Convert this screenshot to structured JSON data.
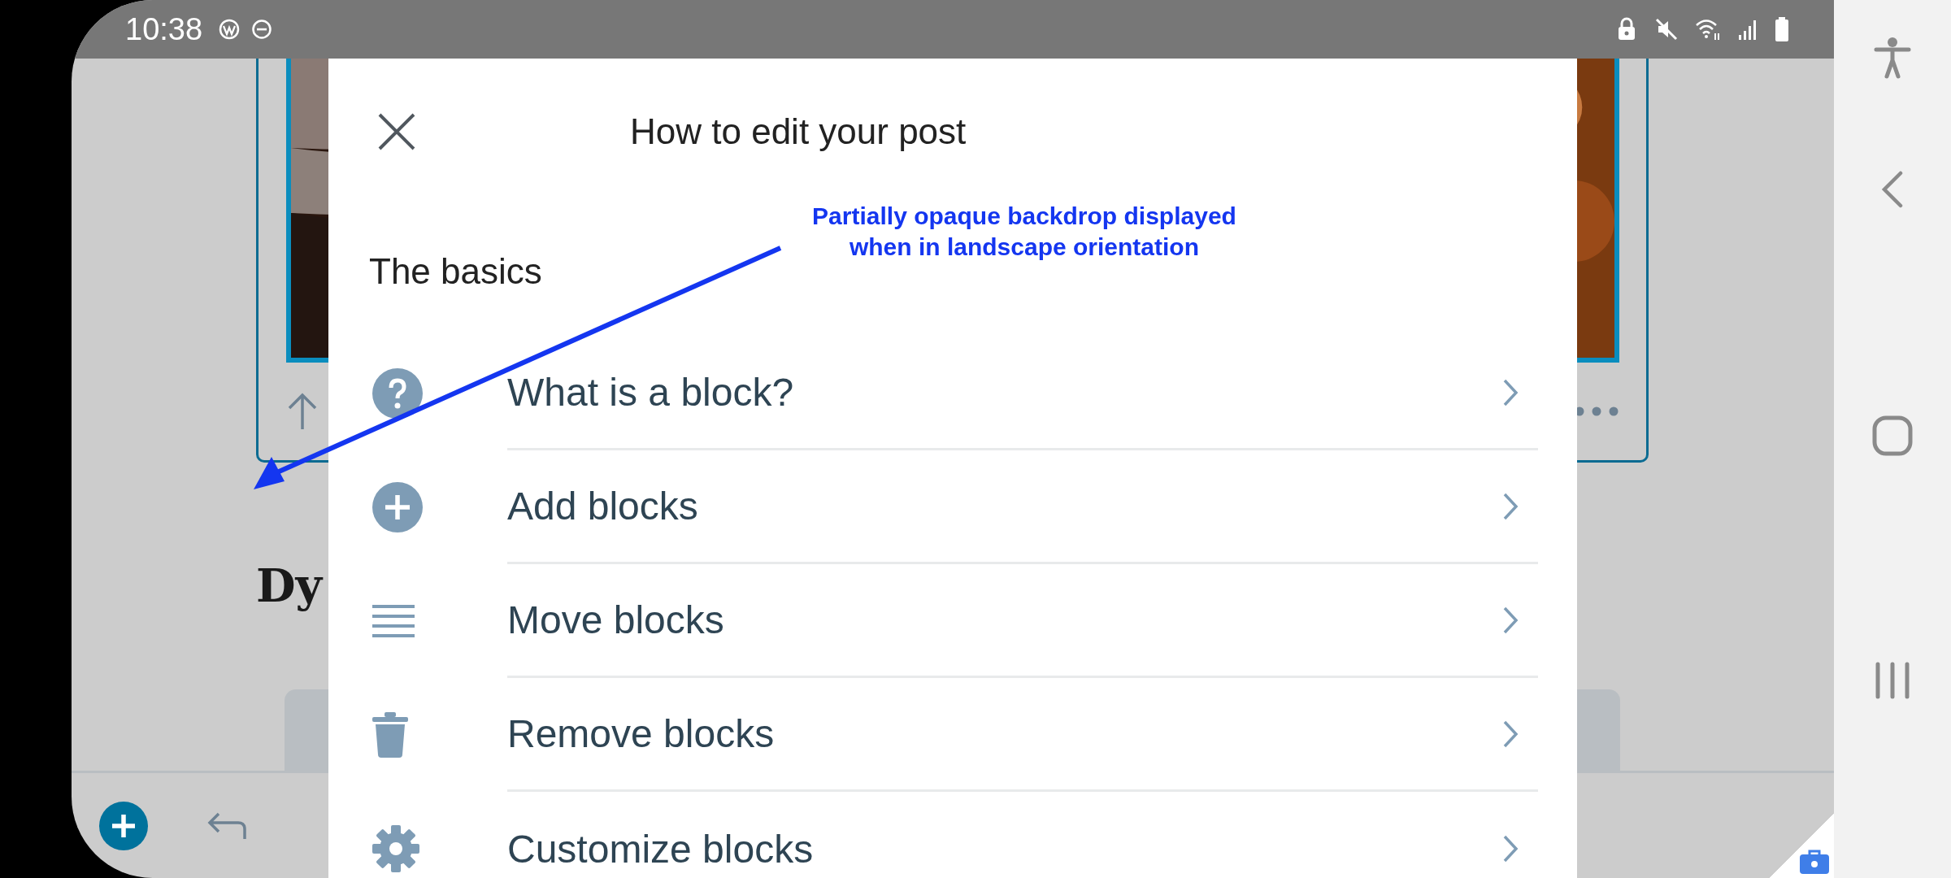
{
  "status_bar": {
    "time": "10:38"
  },
  "editor": {
    "heading": "Dy"
  },
  "modal": {
    "title": "How to edit your post",
    "section": "The basics",
    "items": [
      {
        "label": "What is a block?",
        "kind": "question"
      },
      {
        "label": "Add blocks",
        "kind": "plus"
      },
      {
        "label": "Move blocks",
        "kind": "lines"
      },
      {
        "label": "Remove blocks",
        "kind": "trash"
      },
      {
        "label": "Customize blocks",
        "kind": "gear"
      }
    ]
  },
  "annotation": {
    "text": "Partially opaque backdrop displayed when in landscape orientation"
  }
}
